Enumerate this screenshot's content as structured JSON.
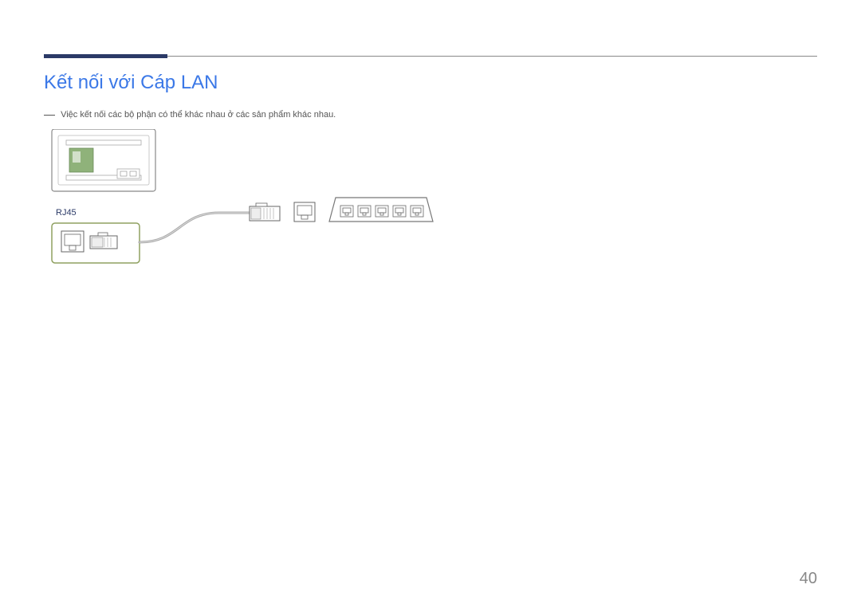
{
  "header": {
    "title": "Kết nối với Cáp LAN"
  },
  "note": "Việc kết nối các bộ phận có thể khác nhau ở các sản phẩm khác nhau.",
  "labels": {
    "port": "RJ45"
  },
  "page_number": "40"
}
